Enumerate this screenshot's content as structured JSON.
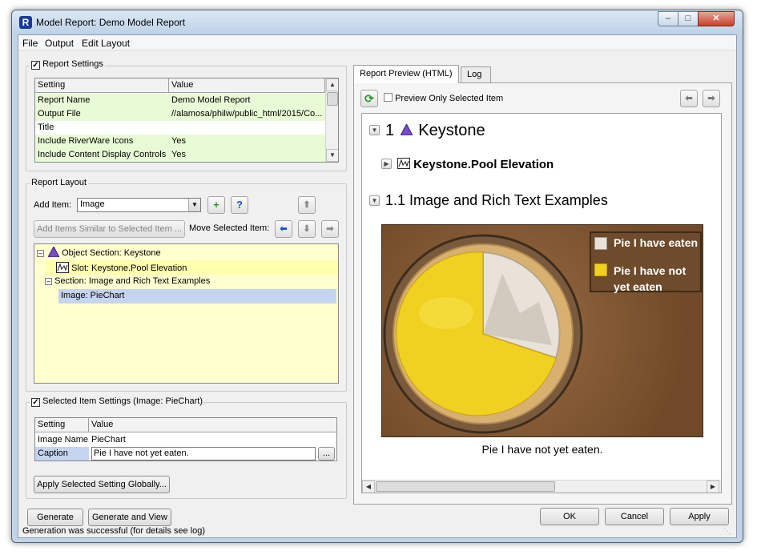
{
  "window": {
    "title": "Model Report: Demo Model Report"
  },
  "menu": [
    "File",
    "Output",
    "Edit Layout"
  ],
  "report_settings": {
    "title": "Report Settings",
    "checked": true,
    "columns": [
      "Setting",
      "Value"
    ],
    "rows": [
      {
        "setting": "Report Name",
        "value": "Demo Model Report"
      },
      {
        "setting": "Output File",
        "value": "//alamosa/philw/public_html/2015/Co..."
      },
      {
        "setting": "Title",
        "value": ""
      },
      {
        "setting": "Include RiverWare Icons",
        "value": "Yes"
      },
      {
        "setting": "Include Content Display Controls",
        "value": "Yes"
      }
    ]
  },
  "report_layout": {
    "title": "Report Layout",
    "add_item_label": "Add Item:",
    "add_item_value": "Image",
    "add_similar_label": "Add Items Similar to Selected Item ...",
    "move_selected_label": "Move Selected Item:",
    "tree": [
      {
        "label": "Object Section: Keystone"
      },
      {
        "label": "Slot: Keystone.Pool Elevation"
      },
      {
        "label": "Section:  Image and Rich Text  Examples"
      },
      {
        "label": "Image: PieChart"
      }
    ]
  },
  "selected_item_settings": {
    "title": "Selected Item Settings (Image: PieChart)",
    "checked": true,
    "columns": [
      "Setting",
      "Value"
    ],
    "rows": [
      {
        "setting": "Image Name",
        "value": "PieChart"
      },
      {
        "setting": "Caption",
        "value": "Pie I have not yet eaten."
      }
    ],
    "browse_label": "...",
    "apply_globally_label": "Apply Selected Setting Globally..."
  },
  "bottom_buttons": {
    "generate": "Generate",
    "generate_and_view": "Generate and View"
  },
  "tabs": [
    {
      "label": "Report Preview (HTML)",
      "active": true
    },
    {
      "label": "Log",
      "active": false
    }
  ],
  "preview_toolbar": {
    "preview_only_label": "Preview Only Selected Item",
    "checked": false
  },
  "preview": {
    "heading1_number": "1",
    "heading1_text": "Keystone",
    "slot_text": "Keystone.Pool Elevation",
    "heading2_text": "1.1 Image and Rich Text Examples",
    "legend": [
      "Pie I have eaten",
      "Pie I have not yet eaten"
    ],
    "caption": "Pie I have not yet eaten."
  },
  "dialog_buttons": {
    "ok": "OK",
    "cancel": "Cancel",
    "apply": "Apply"
  },
  "status": {
    "text": "Generation was successful (for details see log)"
  },
  "colors": {
    "green_row": "#e8fbd6",
    "tree_yellow": "#ffffd0",
    "tree_selected": "#c5d4ef",
    "accent": "#1a56c4"
  }
}
